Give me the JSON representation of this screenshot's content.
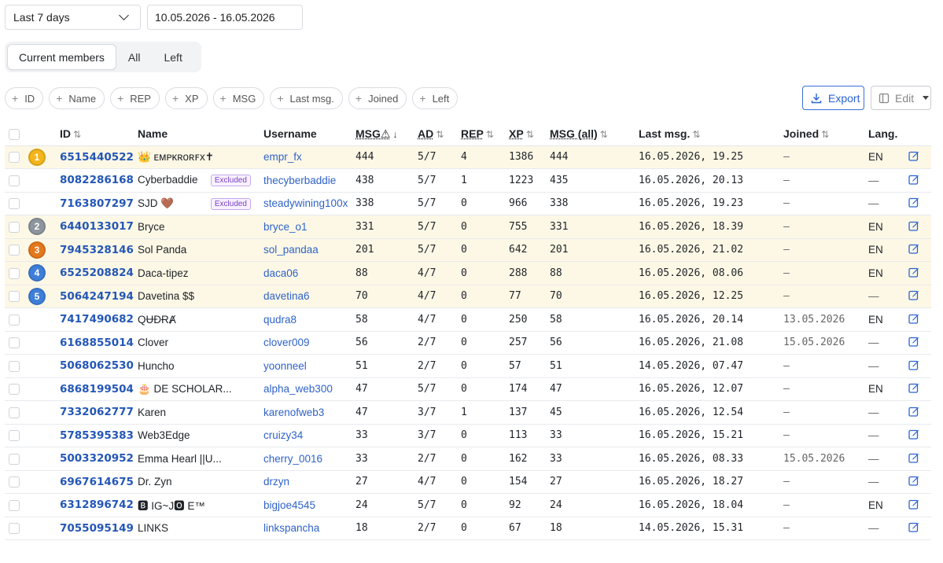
{
  "controls": {
    "period": "Last 7 days",
    "date_range": "10.05.2026 - 16.05.2026",
    "segments": [
      "Current members",
      "All",
      "Left"
    ],
    "active_segment": "Current members",
    "filters": [
      "ID",
      "Name",
      "REP",
      "XP",
      "MSG",
      "Last msg.",
      "Joined",
      "Left"
    ],
    "export_label": "Export",
    "edit_label": "Edit"
  },
  "table": {
    "headers": [
      "ID",
      "Name",
      "Username",
      "MSG⚠",
      "AD",
      "REP",
      "XP",
      "MSG (all)",
      "Last msg.",
      "Joined",
      "Lang."
    ],
    "medal_colors": {
      "1": "#f3b51b",
      "2": "#8d959e",
      "3": "#e5781d",
      "4": "#3f7fd9",
      "5": "#3f7fd9"
    },
    "rows": [
      {
        "rank": "1",
        "id": "6515440522",
        "name": "👑 ᴇᴍᴘᴋʀᴏʀꜰx✝",
        "excluded": "",
        "username": "empr_fx",
        "msg": "444",
        "ad": "5/7",
        "rep": "4",
        "xp": "1386",
        "msg_all": "444",
        "last_msg": "16.05.2026, 19.25",
        "joined": "—",
        "lang": "EN",
        "highlight": true
      },
      {
        "rank": "",
        "id": "8082286168",
        "name": "Cyberbaddie",
        "excluded": "Excluded",
        "username": "thecyberbaddie",
        "msg": "438",
        "ad": "5/7",
        "rep": "1",
        "xp": "1223",
        "msg_all": "435",
        "last_msg": "16.05.2026, 20.13",
        "joined": "—",
        "lang": "—",
        "highlight": false
      },
      {
        "rank": "",
        "id": "7163807297",
        "name": "SJD 🤎",
        "excluded": "Excluded",
        "username": "steadywining100x",
        "msg": "338",
        "ad": "5/7",
        "rep": "0",
        "xp": "966",
        "msg_all": "338",
        "last_msg": "16.05.2026, 19.23",
        "joined": "—",
        "lang": "—",
        "highlight": false
      },
      {
        "rank": "2",
        "id": "6440133017",
        "name": "Bryce",
        "excluded": "",
        "username": "bryce_o1",
        "msg": "331",
        "ad": "5/7",
        "rep": "0",
        "xp": "755",
        "msg_all": "331",
        "last_msg": "16.05.2026, 18.39",
        "joined": "—",
        "lang": "EN",
        "highlight": true
      },
      {
        "rank": "3",
        "id": "7945328146",
        "name": "Sol Panda",
        "excluded": "",
        "username": "sol_pandaa",
        "msg": "201",
        "ad": "5/7",
        "rep": "0",
        "xp": "642",
        "msg_all": "201",
        "last_msg": "16.05.2026, 21.02",
        "joined": "—",
        "lang": "EN",
        "highlight": true
      },
      {
        "rank": "4",
        "id": "6525208824",
        "name": "Daca-tipez",
        "excluded": "",
        "username": "daca06",
        "msg": "88",
        "ad": "4/7",
        "rep": "0",
        "xp": "288",
        "msg_all": "88",
        "last_msg": "16.05.2026, 08.06",
        "joined": "—",
        "lang": "EN",
        "highlight": true
      },
      {
        "rank": "5",
        "id": "5064247194",
        "name": "Davetina $$",
        "excluded": "",
        "username": "davetina6",
        "msg": "70",
        "ad": "4/7",
        "rep": "0",
        "xp": "77",
        "msg_all": "70",
        "last_msg": "16.05.2026, 12.25",
        "joined": "—",
        "lang": "—",
        "highlight": true
      },
      {
        "rank": "",
        "id": "7417490682",
        "name": "QɄĐɌȺ",
        "excluded": "",
        "username": "qudra8",
        "msg": "58",
        "ad": "4/7",
        "rep": "0",
        "xp": "250",
        "msg_all": "58",
        "last_msg": "16.05.2026, 20.14",
        "joined": "13.05.2026",
        "lang": "EN",
        "highlight": false
      },
      {
        "rank": "",
        "id": "6168855014",
        "name": "Clover",
        "excluded": "",
        "username": "clover009",
        "msg": "56",
        "ad": "2/7",
        "rep": "0",
        "xp": "257",
        "msg_all": "56",
        "last_msg": "16.05.2026, 21.08",
        "joined": "15.05.2026",
        "lang": "—",
        "highlight": false
      },
      {
        "rank": "",
        "id": "5068062530",
        "name": "Huncho",
        "excluded": "",
        "username": "yoonneel",
        "msg": "51",
        "ad": "2/7",
        "rep": "0",
        "xp": "57",
        "msg_all": "51",
        "last_msg": "14.05.2026, 07.47",
        "joined": "—",
        "lang": "—",
        "highlight": false
      },
      {
        "rank": "",
        "id": "6868199504",
        "name": "🎂 DE SCHOLAR...",
        "excluded": "",
        "username": "alpha_web300",
        "msg": "47",
        "ad": "5/7",
        "rep": "0",
        "xp": "174",
        "msg_all": "47",
        "last_msg": "16.05.2026, 12.07",
        "joined": "—",
        "lang": "EN",
        "highlight": false
      },
      {
        "rank": "",
        "id": "7332062777",
        "name": "Karen",
        "excluded": "",
        "username": "karenofweb3",
        "msg": "47",
        "ad": "3/7",
        "rep": "1",
        "xp": "137",
        "msg_all": "45",
        "last_msg": "16.05.2026, 12.54",
        "joined": "—",
        "lang": "—",
        "highlight": false
      },
      {
        "rank": "",
        "id": "5785395383",
        "name": "Web3Edge",
        "excluded": "",
        "username": "cruizy34",
        "msg": "33",
        "ad": "3/7",
        "rep": "0",
        "xp": "113",
        "msg_all": "33",
        "last_msg": "16.05.2026, 15.21",
        "joined": "—",
        "lang": "—",
        "highlight": false
      },
      {
        "rank": "",
        "id": "5003320952",
        "name": "Emma Hearl ||U...",
        "excluded": "",
        "username": "cherry_0016",
        "msg": "33",
        "ad": "2/7",
        "rep": "0",
        "xp": "162",
        "msg_all": "33",
        "last_msg": "16.05.2026, 08.33",
        "joined": "15.05.2026",
        "lang": "—",
        "highlight": false
      },
      {
        "rank": "",
        "id": "6967614675",
        "name": "Dr. Zyn",
        "excluded": "",
        "username": "drzyn",
        "msg": "27",
        "ad": "4/7",
        "rep": "0",
        "xp": "154",
        "msg_all": "27",
        "last_msg": "16.05.2026, 18.27",
        "joined": "—",
        "lang": "—",
        "highlight": false
      },
      {
        "rank": "",
        "id": "6312896742",
        "name": "🅱 IG~J🅾 E™",
        "excluded": "",
        "username": "bigjoe4545",
        "msg": "24",
        "ad": "5/7",
        "rep": "0",
        "xp": "92",
        "msg_all": "24",
        "last_msg": "16.05.2026, 18.04",
        "joined": "—",
        "lang": "EN",
        "highlight": false
      },
      {
        "rank": "",
        "id": "7055095149",
        "name": "LINKS",
        "excluded": "",
        "username": "linkspancha",
        "msg": "18",
        "ad": "2/7",
        "rep": "0",
        "xp": "67",
        "msg_all": "18",
        "last_msg": "14.05.2026, 15.31",
        "joined": "—",
        "lang": "—",
        "highlight": false
      }
    ]
  }
}
